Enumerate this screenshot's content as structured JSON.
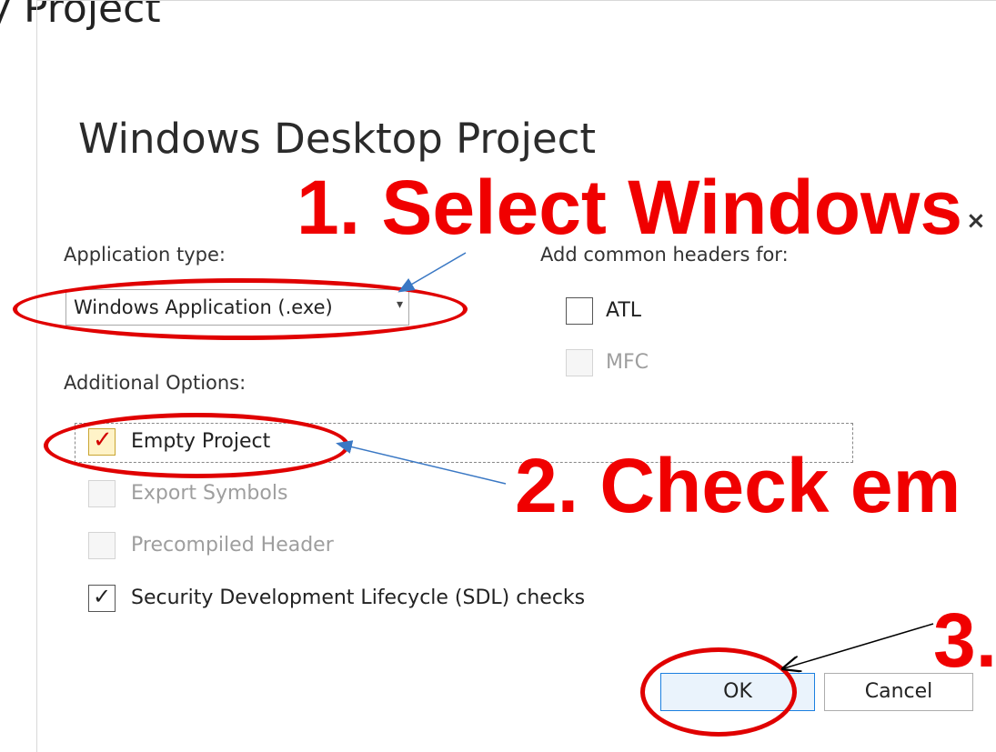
{
  "background": {
    "window_title": "y Project"
  },
  "dialog": {
    "close_glyph": "×",
    "title": "Windows Desktop Project",
    "application_type_label": "Application type:",
    "application_type_value": "Windows Application (.exe)",
    "common_headers_label": "Add common headers for:",
    "headers": [
      {
        "label": "ATL",
        "checked": false,
        "disabled": false
      },
      {
        "label": "MFC",
        "checked": false,
        "disabled": true
      }
    ],
    "additional_options_label": "Additional Options:",
    "options": [
      {
        "label": "Empty Project",
        "checked": true,
        "disabled": false
      },
      {
        "label": "Export Symbols",
        "checked": false,
        "disabled": true
      },
      {
        "label": "Precompiled Header",
        "checked": false,
        "disabled": true
      },
      {
        "label": "Security Development Lifecycle (SDL) checks",
        "checked": true,
        "disabled": false
      }
    ],
    "ok_label": "OK",
    "cancel_label": "Cancel"
  },
  "annotations": {
    "step1": "1. Select Windows",
    "step2": "2. Check em",
    "step3": "3.",
    "color": "#f00000"
  }
}
